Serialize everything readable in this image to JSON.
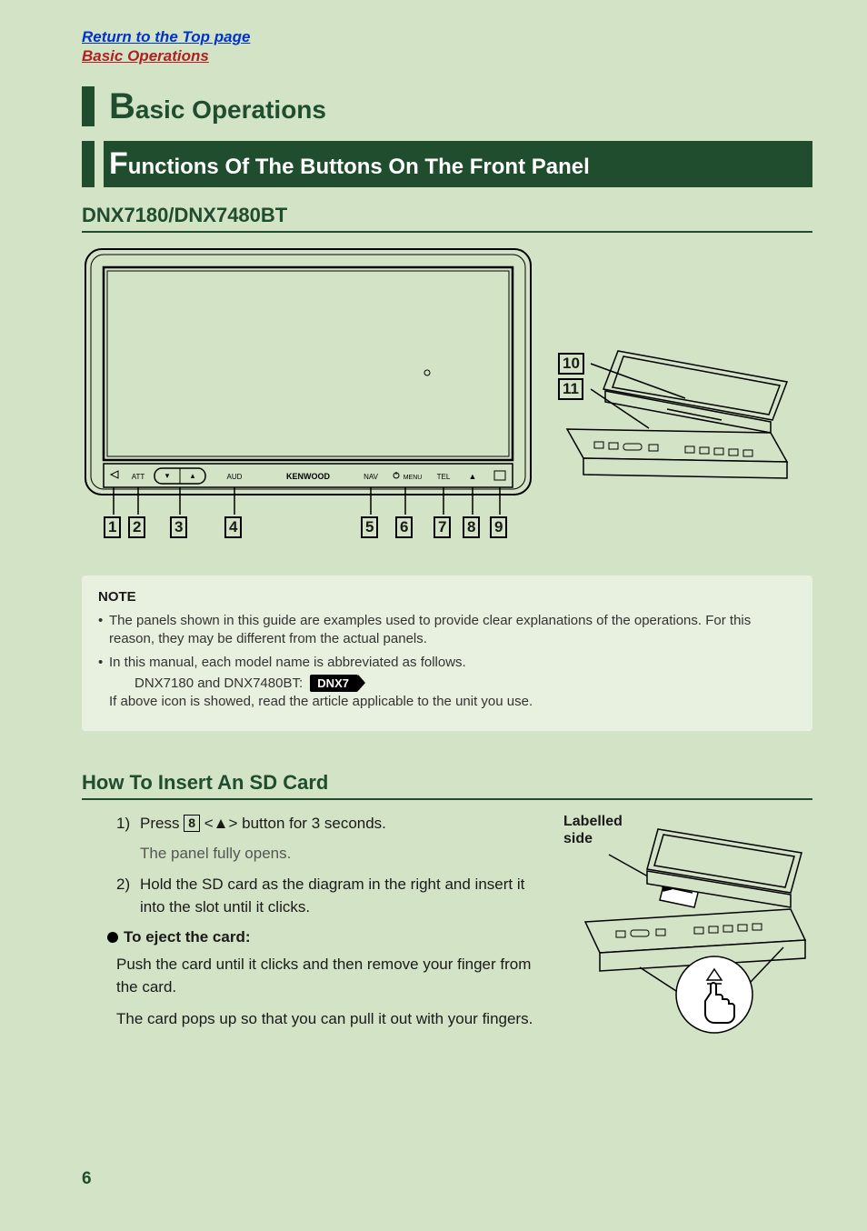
{
  "links": {
    "top": "Return to the Top page",
    "section": "Basic Operations"
  },
  "h1": {
    "big": "B",
    "rest": "asic Operations"
  },
  "h2": {
    "big": "F",
    "rest": "unctions Of The Buttons On The Front Panel"
  },
  "model_heading": "DNX7180/DNX7480BT",
  "panel": {
    "brand": "KENWOOD",
    "buttons": {
      "att": "ATT",
      "aud": "AUD",
      "nav": "NAV",
      "menu": "MENU",
      "tel": "TEL"
    }
  },
  "callouts_bottom": [
    "1",
    "2",
    "3",
    "4",
    "5",
    "6",
    "7",
    "8",
    "9"
  ],
  "callouts_side": [
    "10",
    "11"
  ],
  "note": {
    "title": "NOTE",
    "item1": "The panels shown in this guide are examples used to provide clear explanations of the operations. For this reason, they may be different from the actual panels.",
    "item2a": "In this manual, each model name is abbreviated as follows.",
    "item2b": "DNX7180 and DNX7480BT:",
    "badge": "DNX7",
    "item2c": "If above icon is showed, read the article applicable to the unit you use."
  },
  "sd": {
    "heading": "How To Insert An SD Card",
    "step1_a": "Press",
    "step1_box": "8",
    "step1_b": "<▲> button for 3 seconds.",
    "step1_sub": "The panel fully opens.",
    "step2": "Hold the SD card as the diagram in the right and insert it into the slot until it clicks.",
    "eject_head": "To eject the card:",
    "eject_p1": "Push the card until it clicks and then remove your finger from the card.",
    "eject_p2": "The card pops up so that you can pull it out with your fingers.",
    "label": "Labelled side"
  },
  "page_number": "6"
}
